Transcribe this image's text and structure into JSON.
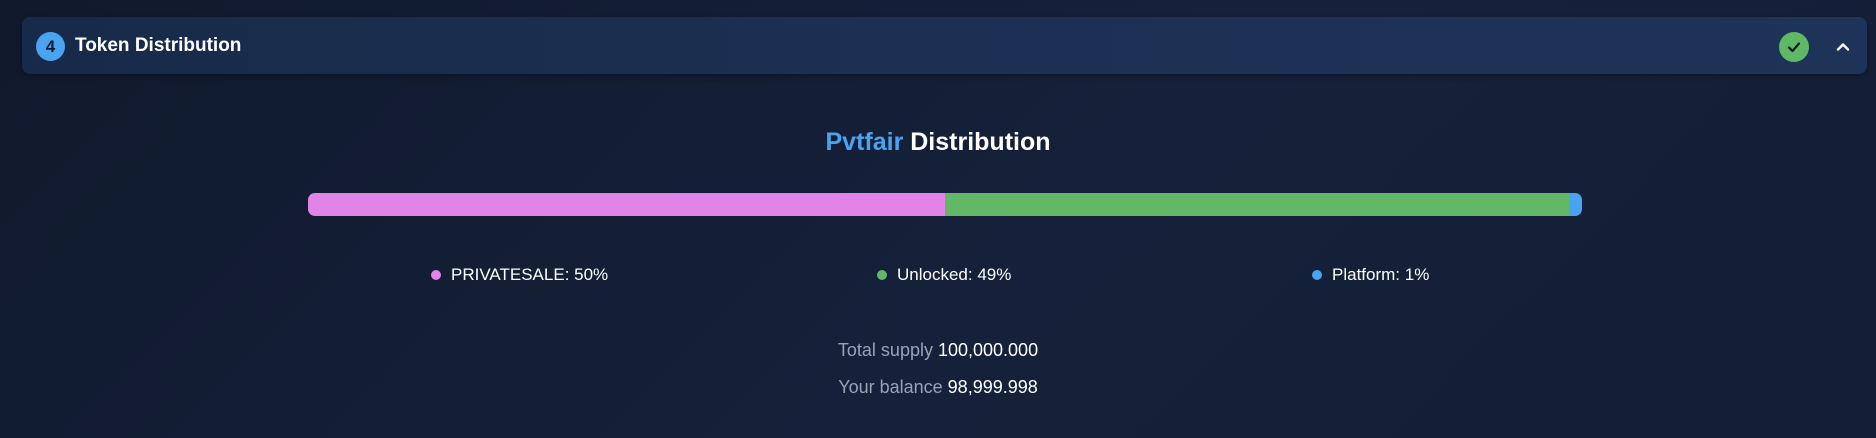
{
  "section": {
    "step_number": "4",
    "title": "Token Distribution",
    "status": "completed",
    "status_icon": "check-icon",
    "toggle_icon": "chevron-up-icon"
  },
  "distribution": {
    "title_brand": "Pvtfair",
    "title_rest": "Distribution",
    "segments": [
      {
        "label": "PRIVATESALE: 50%",
        "name": "PRIVATESALE",
        "percent": 50,
        "color": "#e283e8"
      },
      {
        "label": "Unlocked: 49%",
        "name": "Unlocked",
        "percent": 49,
        "color": "#63b868"
      },
      {
        "label": "Platform: 1%",
        "name": "Platform",
        "percent": 1,
        "color": "#4aa3ef"
      }
    ]
  },
  "stats": {
    "total_supply_label": "Total supply",
    "total_supply_value": "100,000.000",
    "balance_label": "Your balance",
    "balance_value": "98,999.998"
  },
  "colors": {
    "accent": "#4aa3ef",
    "success": "#5fb865",
    "header_bg": "#1b3053",
    "page_bg": "#131d33"
  }
}
